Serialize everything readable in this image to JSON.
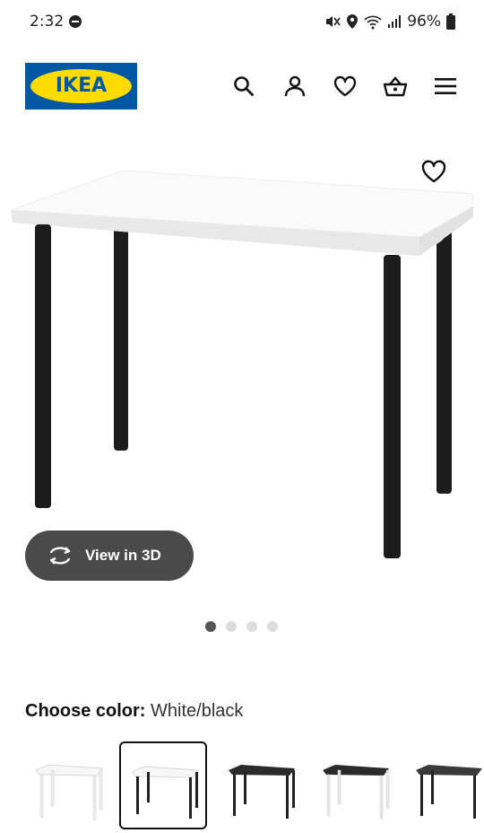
{
  "status_bar": {
    "time": "2:32",
    "battery": "96%",
    "icons": [
      "do-not-disturb-icon",
      "mute-icon",
      "location-icon",
      "wifi-icon",
      "signal-icon",
      "battery-icon"
    ]
  },
  "header": {
    "logo_text": "IKEA",
    "icons": [
      "search-icon",
      "account-icon",
      "heart-icon",
      "basket-icon",
      "menu-icon"
    ]
  },
  "product": {
    "view_3d_label": "View in 3D",
    "image_count": 4,
    "active_image": 1
  },
  "color_picker": {
    "label": "Choose color:",
    "value": "White/black",
    "options": [
      {
        "name": "White",
        "top": "#f7f7f7",
        "legs": "#f0f0f0"
      },
      {
        "name": "White/black",
        "top": "#f7f7f7",
        "legs": "#222222",
        "selected": true
      },
      {
        "name": "Black-brown",
        "top": "#2b2b2b",
        "legs": "#222222"
      },
      {
        "name": "Black-brown/white",
        "top": "#2b2b2b",
        "legs": "#e8e8e8"
      },
      {
        "name": "Dark grey/black",
        "top": "#3a3a3a",
        "legs": "#222222"
      }
    ]
  },
  "colors": {
    "ikea_blue": "#0058a3",
    "ikea_yellow": "#ffdb00",
    "view3d_bg": "#4a4a4a"
  }
}
